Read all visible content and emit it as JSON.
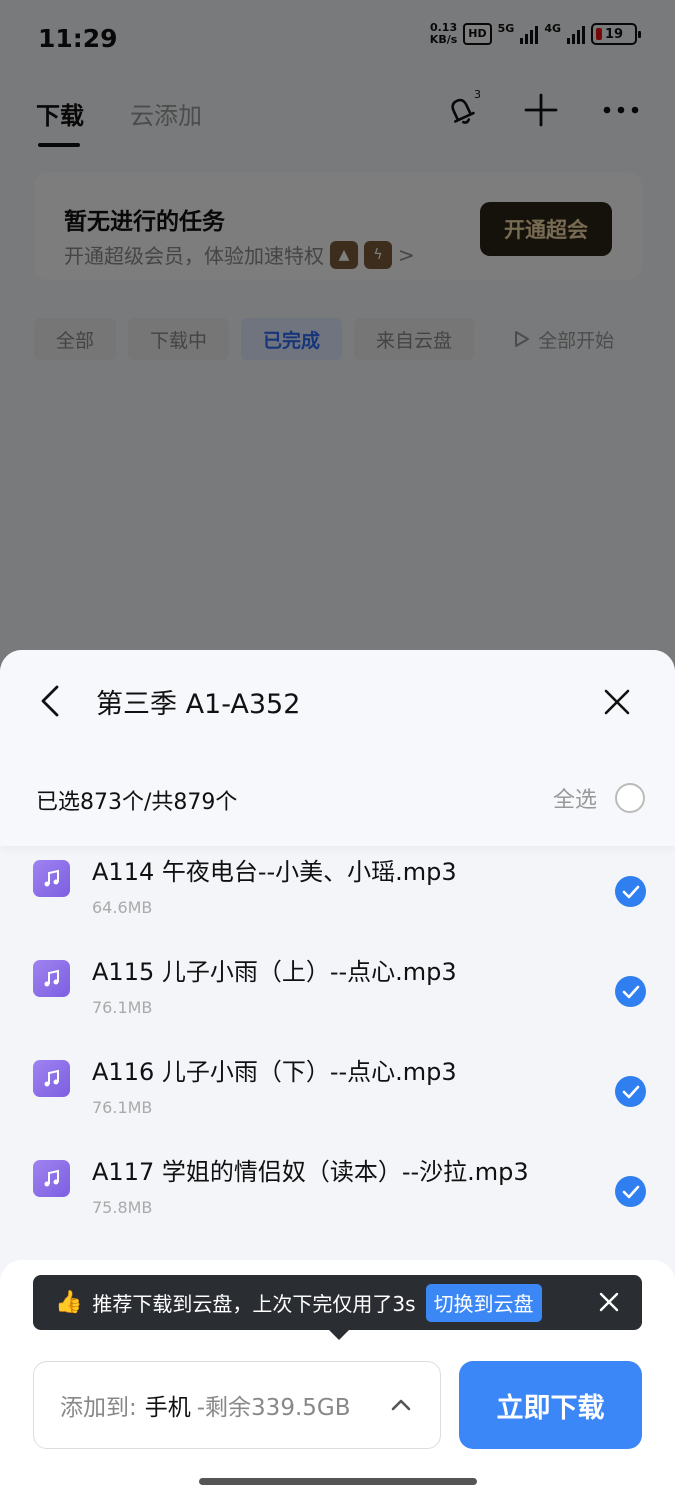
{
  "status_bar": {
    "time": "11:29",
    "net_speed": "0.13",
    "net_speed_unit": "KB/s",
    "hd_label": "HD",
    "signal1_label": "5G",
    "signal2_label": "4G",
    "battery": "19"
  },
  "header": {
    "tabs": [
      {
        "label": "下载",
        "active": true
      },
      {
        "label": "云添加",
        "active": false
      }
    ],
    "bell_count": "3",
    "icons": [
      "bell-icon",
      "plus-icon",
      "more-icon"
    ]
  },
  "vip_card": {
    "title": "暂无进行的任务",
    "subtitle": "开通超级会员，体验加速特权",
    "arrow": ">",
    "button": "开通超会"
  },
  "filters": {
    "chips": [
      {
        "label": "全部",
        "active": false
      },
      {
        "label": "下载中",
        "active": false
      },
      {
        "label": "已完成",
        "active": true
      },
      {
        "label": "来自云盘",
        "active": false
      }
    ],
    "start_all": "全部开始"
  },
  "sheet": {
    "title": "第三季 A1-A352",
    "selected_count": "已选873个/共879个",
    "select_all": "全选",
    "files": [
      {
        "name": "A114 午夜电台--小美、小瑶.mp3",
        "size": "64.6MB",
        "checked": true
      },
      {
        "name": "A115 儿子小雨（上）--点心.mp3",
        "size": "76.1MB",
        "checked": true
      },
      {
        "name": "A116 儿子小雨（下）--点心.mp3",
        "size": "76.1MB",
        "checked": true
      },
      {
        "name": "A117 学姐的情侣奴（读本）--沙拉.mp3",
        "size": "75.8MB",
        "checked": true
      }
    ]
  },
  "toast": {
    "text": "推荐下载到云盘，上次下完仅用了3s",
    "switch_label": "切换到云盘"
  },
  "destination": {
    "prefix": "添加到:",
    "value": "手机",
    "remaining": "-剩余339.5GB"
  },
  "download_button": "立即下载",
  "colors": {
    "accent": "#3c87f7",
    "vip_button_bg": "#2b2216",
    "vip_button_text": "#f0d6a6",
    "file_icon": "#8b6ee8"
  }
}
